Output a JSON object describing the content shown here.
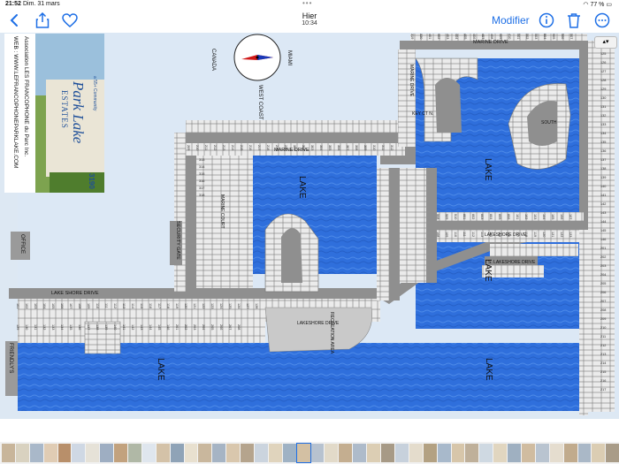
{
  "status": {
    "time": "21:52",
    "date": "Dim. 31 mars",
    "battery": "77 %"
  },
  "nav": {
    "title": "Hier",
    "subtitle": "10:34",
    "edit_label": "Modifier"
  },
  "map": {
    "sign": {
      "line1": "Park Lake",
      "line2": "ESTATES",
      "tagline": "a 55+ Community",
      "number": "3190"
    },
    "side_text_1": "Association LES FRANCOPHONE du Parc Inc.",
    "side_text_2": "WEB : WWW.LEFRANCOPHONEPARKLAKE.COM",
    "compass": {
      "north": "MIAMI",
      "west": "CANADA",
      "south": "WEST COAST"
    },
    "labels": {
      "office": "OFFICE",
      "friendly": "FRIENDLY'S",
      "security_gate": "SECURITY GATE",
      "lake_shore_drive_left": "LAKE SHORE DRIVE",
      "lakeshore_drive_mid": "LAKESHORE DRIVE",
      "lakeshore_drive_right": "LAKESHORE DRIVE",
      "s_lakeshore_drive": "S. LAKESHORE DRIVE",
      "marine_drive_top": "MARINE DRIVE",
      "marine_drive_mid": "MARINE DRIVE",
      "marine_court": "MARINE COURT",
      "marine_drive_v": "MARINE DRIVE",
      "key_ct": "KEY CT N.",
      "south": "SOUTH",
      "recreation": "RECREATION AREA",
      "lake_1": "LAKE",
      "lake_2": "LAKE",
      "lake_3": "LAKE",
      "lake_4": "LAKE",
      "lake_5": "LAKE"
    },
    "lot_samples": [
      "101",
      "102",
      "103",
      "104",
      "105",
      "106",
      "107",
      "108",
      "109",
      "110",
      "111",
      "112",
      "113",
      "114",
      "115",
      "116",
      "117",
      "118",
      "119",
      "120",
      "121",
      "122",
      "123",
      "124",
      "125",
      "126",
      "127",
      "128",
      "129",
      "130",
      "131",
      "132",
      "133",
      "134",
      "135",
      "136",
      "137",
      "138",
      "139",
      "140",
      "141",
      "142",
      "143",
      "144",
      "145",
      "146",
      "201",
      "202",
      "203",
      "204",
      "205",
      "206",
      "207",
      "208",
      "209",
      "210",
      "211",
      "212",
      "213",
      "214",
      "215",
      "216",
      "217",
      "218",
      "219",
      "220",
      "301",
      "302",
      "303",
      "304",
      "305",
      "306",
      "307",
      "308",
      "309",
      "310",
      "311",
      "312",
      "313",
      "314",
      "315",
      "316",
      "317",
      "318",
      "319",
      "320",
      "401",
      "402",
      "403",
      "404",
      "405",
      "406",
      "407",
      "408",
      "409",
      "410",
      "501",
      "502",
      "503",
      "504",
      "505",
      "506",
      "507",
      "508",
      "509",
      "510",
      "601",
      "602",
      "603",
      "604",
      "605",
      "606"
    ]
  },
  "thumbnail_colors": [
    "#c8b59a",
    "#d9d2c0",
    "#a9b8c9",
    "#e0ccb4",
    "#b88f6a",
    "#cfd8e4",
    "#e6e2d8",
    "#9eaec2",
    "#c2a27e",
    "#b0b8a6",
    "#dfe6ee",
    "#d4c2a8",
    "#8fa3b7",
    "#e8e0cf",
    "#c9b79d",
    "#a6b4c4",
    "#d9c7ad",
    "#b5a48d",
    "#cbd4de",
    "#e0d4bd",
    "#9fb2c4",
    "#d3c0a3",
    "#b7c2cf",
    "#e2dac9",
    "#c4ae90",
    "#aebbca",
    "#dcceb4",
    "#a79a86",
    "#c7d1dc",
    "#e4dccc",
    "#b3a182",
    "#a8b9cb",
    "#d7c6aa",
    "#bfb09a",
    "#cfd9e2",
    "#e1d6c0",
    "#9fb0c1",
    "#d0bca0",
    "#b9c4d0",
    "#e5ddcf",
    "#c1ab8d",
    "#aab8c7",
    "#dbcdb3",
    "#a99c88"
  ]
}
